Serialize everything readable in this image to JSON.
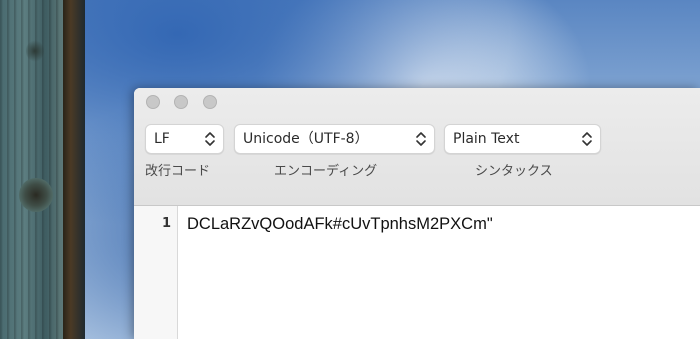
{
  "toolbar": {
    "line_ending": {
      "value": "LF",
      "label": "改行コード"
    },
    "encoding": {
      "value": "Unicode（UTF-8）",
      "label": "エンコーディング"
    },
    "syntax": {
      "value": "Plain Text",
      "label": "シンタックス"
    }
  },
  "editor": {
    "lines": [
      {
        "number": "1",
        "text": "DCLaRZvQOodAFk#cUvTpnhsM2PXCm\""
      }
    ]
  }
}
